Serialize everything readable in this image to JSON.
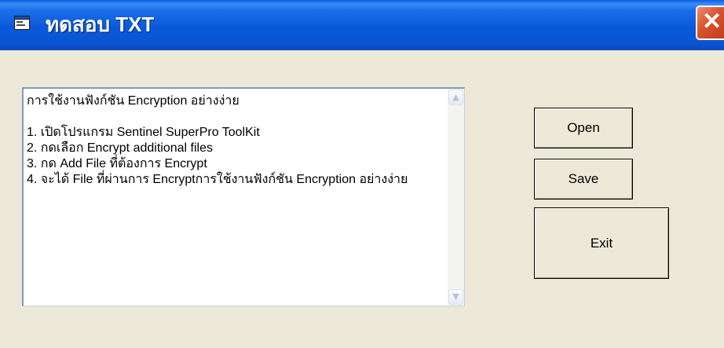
{
  "window": {
    "title": "ทดสอบ TXT",
    "app_icon": "form-icon",
    "close_label": "✕",
    "colors": {
      "titlebar": "#0A58DA",
      "body": "#ECE9D8",
      "close": "#D8542F"
    }
  },
  "textbox": {
    "content": "การใช้งานฟังก์ชัน Encryption อย่างง่าย\n\n1. เปิดโปรแกรม Sentinel SuperPro ToolKit\n2. กดเลือก Encrypt additional files\n3. กด Add File ที่ต้องการ Encrypt\n4. จะได้ File ที่ผ่านการ Encryptการใช้งานฟังก์ชัน Encryption อย่างง่าย",
    "scroll_up_icon": "scroll-up-arrow-icon",
    "scroll_down_icon": "scroll-down-arrow-icon"
  },
  "buttons": {
    "open": "Open",
    "save": "Save",
    "exit": "Exit"
  }
}
